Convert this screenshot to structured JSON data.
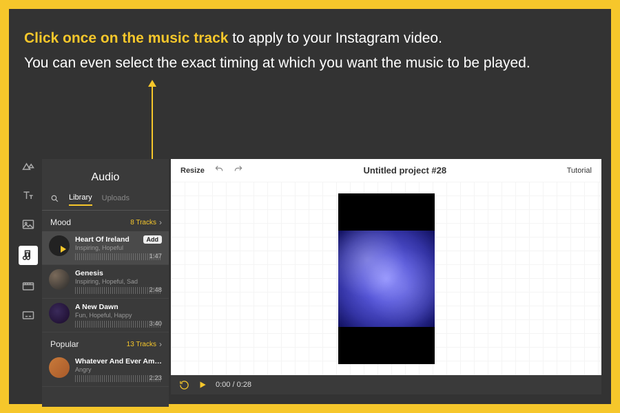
{
  "headline": {
    "bold": "Click once on the music track",
    "rest": " to apply to your Instagram video.",
    "line2": "You can even select the exact timing at which you want the music to be played."
  },
  "rail": {
    "icons": [
      "design",
      "text",
      "image",
      "audio",
      "video",
      "captions"
    ]
  },
  "audio": {
    "title": "Audio",
    "tabs": {
      "library": "Library",
      "uploads": "Uploads"
    },
    "sections": [
      {
        "name": "Mood",
        "count": "8 Tracks",
        "tracks": [
          {
            "name": "Heart Of Ireland",
            "tags": "Inspiring, Hopeful",
            "duration": "1:47",
            "add": "Add",
            "selected": true
          },
          {
            "name": "Genesis",
            "tags": "Inspiring, Hopeful, Sad",
            "duration": "2:48"
          },
          {
            "name": "A New Dawn",
            "tags": "Fun, Hopeful, Happy",
            "duration": "3:40"
          }
        ]
      },
      {
        "name": "Popular",
        "count": "13 Tracks",
        "tracks": [
          {
            "name": "Whatever And Ever Amen",
            "tags": "Angry",
            "duration": "2:23"
          }
        ]
      }
    ]
  },
  "editor": {
    "resize": "Resize",
    "project": "Untitled project #28",
    "tutorial": "Tutorial",
    "time": "0:00 / 0:28"
  }
}
